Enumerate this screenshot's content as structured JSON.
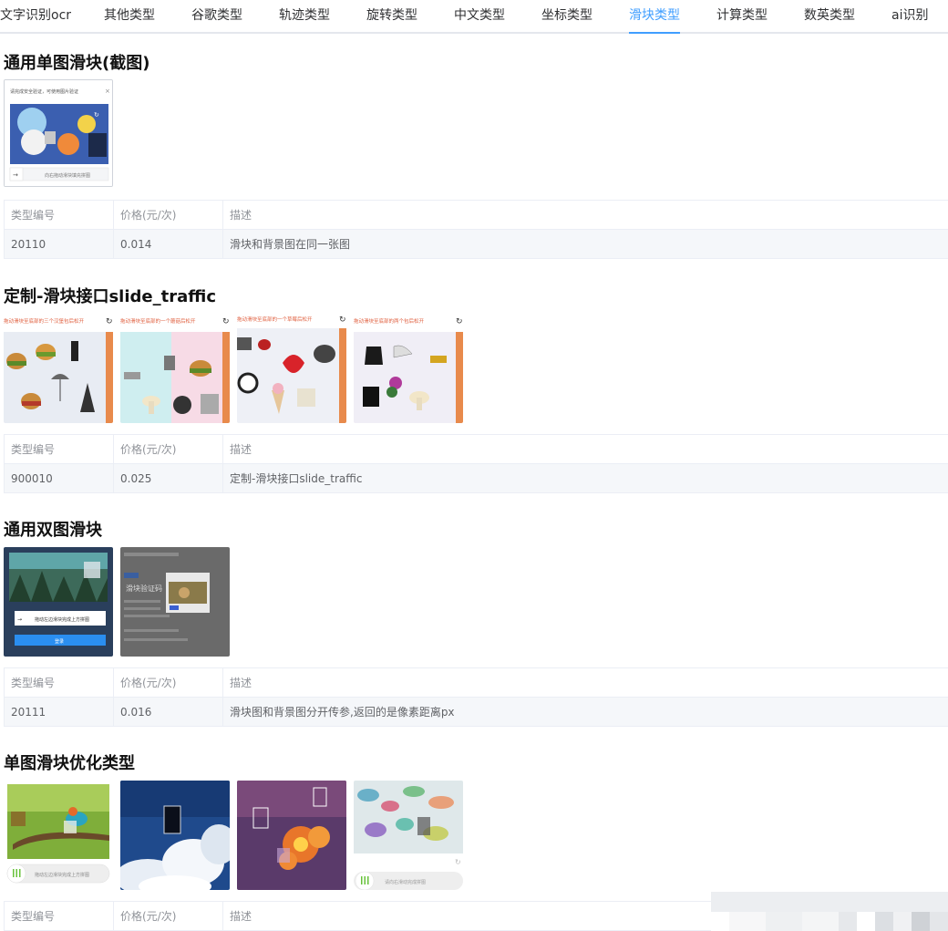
{
  "tabs": [
    {
      "label": "文字识别ocr",
      "active": false
    },
    {
      "label": "其他类型",
      "active": false
    },
    {
      "label": "谷歌类型",
      "active": false
    },
    {
      "label": "轨迹类型",
      "active": false
    },
    {
      "label": "旋转类型",
      "active": false
    },
    {
      "label": "中文类型",
      "active": false
    },
    {
      "label": "坐标类型",
      "active": false
    },
    {
      "label": "滑块类型",
      "active": true
    },
    {
      "label": "计算类型",
      "active": false
    },
    {
      "label": "数英类型",
      "active": false
    },
    {
      "label": "ai识别",
      "active": false
    }
  ],
  "colors": {
    "accent": "#409eff",
    "slider_orange": "#e88a4c",
    "green_handle": "#67c23a"
  },
  "table_headers": {
    "type_id": "类型编号",
    "price": "价格(元/次)",
    "desc": "描述"
  },
  "sections": [
    {
      "title": "通用单图滑块(截图)",
      "sample_texts": {
        "dialog_title": "请完成安全验证，可使用图片验证",
        "close": "×",
        "slider_hint": "向右拖动滑块填充拼图",
        "arrow": "→"
      },
      "row": {
        "type_id": "20110",
        "price": "0.014",
        "desc": "滑块和背景图在同一张图"
      }
    },
    {
      "title": "定制-滑块接口slide_traffic",
      "sample_texts": [
        {
          "instruction": "拖动滑块至底部的三个汉堡包后松开",
          "refresh": "↻"
        },
        {
          "instruction": "拖动滑块至底部的一个蘑菇后松开",
          "refresh": "↻"
        },
        {
          "instruction": "拖动滑块至底部的一个草莓后松开",
          "refresh": "↻"
        },
        {
          "instruction": "拖动滑块至底部的两个包后松开",
          "refresh": "↻"
        }
      ],
      "row": {
        "type_id": "900010",
        "price": "0.025",
        "desc": "定制-滑块接口slide_traffic"
      }
    },
    {
      "title": "通用双图滑块",
      "sample_texts": {
        "slider_hint": "拖动左边滑块完成上方拼图",
        "button": "登录",
        "page_heading": "滑块验证码"
      },
      "row": {
        "type_id": "20111",
        "price": "0.016",
        "desc": "滑块图和背景图分开传参,返回的是像素距离px"
      }
    },
    {
      "title": "单图滑块优化类型",
      "sample_texts": {
        "slider_hint_1": "拖动左边滑块完成上方拼图",
        "slider_hint_2": "请向右滑动完成拼图",
        "refresh": "↻"
      },
      "row": {
        "type_id": "",
        "price": "",
        "desc": ""
      }
    }
  ]
}
